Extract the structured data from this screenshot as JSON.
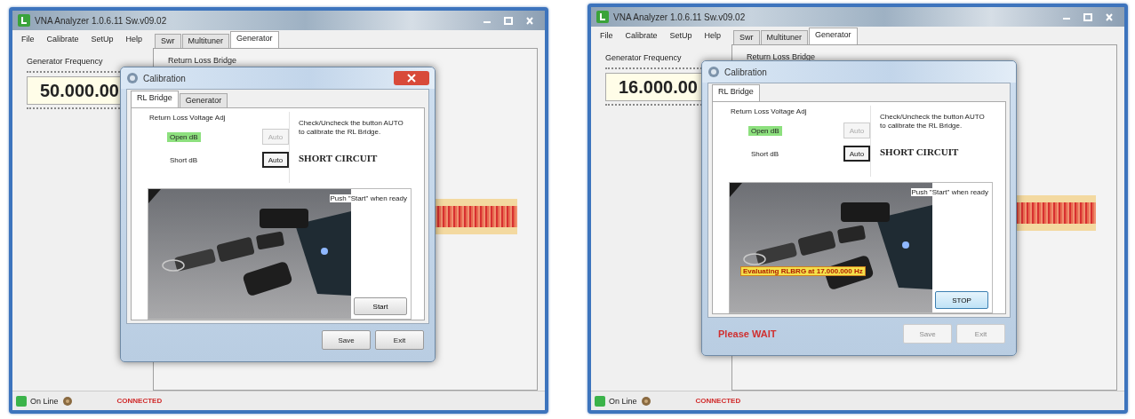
{
  "windows": [
    {
      "title": "VNA Analyzer 1.0.6.11 Sw.v09.02",
      "menu": [
        "File",
        "Calibrate",
        "SetUp",
        "Help"
      ],
      "tabs": [
        {
          "label": "Swr",
          "selected": false
        },
        {
          "label": "Multituner",
          "selected": false
        },
        {
          "label": "Generator",
          "selected": true
        }
      ],
      "generator": {
        "label": "Generator Frequency",
        "frequency": "50.000.00"
      },
      "panel_label": "Return Loss Bridge",
      "status": {
        "online": "On Line",
        "connection": "CONNECTED"
      },
      "dialog": {
        "title": "Calibration",
        "close_highlighted": true,
        "tabs": [
          {
            "label": "RL Bridge",
            "selected": true
          },
          {
            "label": "Generator",
            "selected": false
          }
        ],
        "group_title": "Return Loss Voltage Adj",
        "rows": [
          {
            "label": "Open dB",
            "highlighted": true,
            "button": "Auto",
            "disabled": true
          },
          {
            "label": "Short dB",
            "highlighted": false,
            "button": "Auto",
            "disabled": false
          }
        ],
        "instruction": "Check/Uncheck the button AUTO to calibrate the RL Bridge.",
        "mode": "SHORT CIRCUIT",
        "prompt": "Push \"Start\" when ready",
        "action": {
          "label": "Start",
          "focused": false
        },
        "buttons": [
          {
            "label": "Save",
            "disabled": false
          },
          {
            "label": "Exit",
            "disabled": false
          }
        ]
      }
    },
    {
      "title": "VNA Analyzer 1.0.6.11 Sw.v09.02",
      "menu": [
        "File",
        "Calibrate",
        "SetUp",
        "Help"
      ],
      "tabs": [
        {
          "label": "Swr",
          "selected": false
        },
        {
          "label": "Multituner",
          "selected": false
        },
        {
          "label": "Generator",
          "selected": true
        }
      ],
      "generator": {
        "label": "Generator Frequency",
        "frequency": "16.000.00"
      },
      "panel_label": "Return Loss Bridge",
      "status": {
        "online": "On Line",
        "connection": "CONNECTED"
      },
      "dialog": {
        "title": "Calibration",
        "close_highlighted": false,
        "tabs": [
          {
            "label": "RL Bridge",
            "selected": true
          }
        ],
        "group_title": "Return Loss Voltage Adj",
        "rows": [
          {
            "label": "Open dB",
            "highlighted": true,
            "button": "Auto",
            "disabled": true
          },
          {
            "label": "Short dB",
            "highlighted": false,
            "button": "Auto",
            "disabled": false
          }
        ],
        "instruction": "Check/Uncheck the button AUTO to calibrate the RL Bridge.",
        "mode": "SHORT CIRCUIT",
        "prompt": "Push \"Start\" when ready",
        "progress": "Evaluating RLBRG at 17.000.000 Hz",
        "action": {
          "label": "STOP",
          "focused": true
        },
        "footer_message": "Please WAIT",
        "buttons": [
          {
            "label": "Save",
            "disabled": true
          },
          {
            "label": "Exit",
            "disabled": true
          }
        ]
      }
    }
  ]
}
